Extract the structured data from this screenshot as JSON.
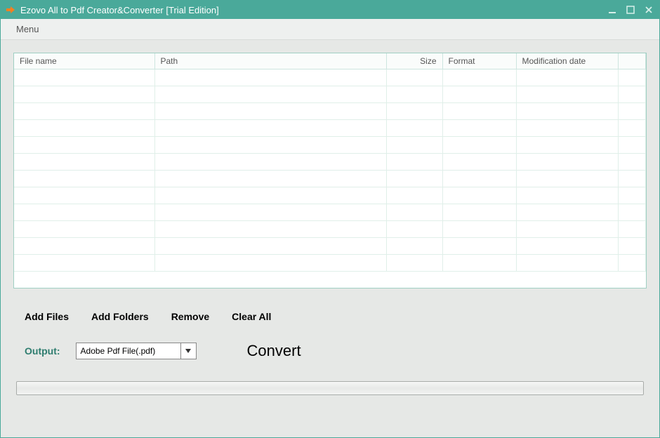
{
  "window": {
    "title": "Ezovo All to Pdf Creator&Converter [Trial Edition]"
  },
  "menubar": {
    "menu": "Menu"
  },
  "table": {
    "columns": {
      "filename": "File name",
      "path": "Path",
      "size": "Size",
      "format": "Format",
      "date": "Modification date"
    }
  },
  "toolbar": {
    "add_files": "Add Files",
    "add_folders": "Add Folders",
    "remove": "Remove",
    "clear_all": "Clear All"
  },
  "output": {
    "label": "Output:",
    "selected": "Adobe Pdf File(.pdf)"
  },
  "convert": {
    "label": "Convert"
  }
}
